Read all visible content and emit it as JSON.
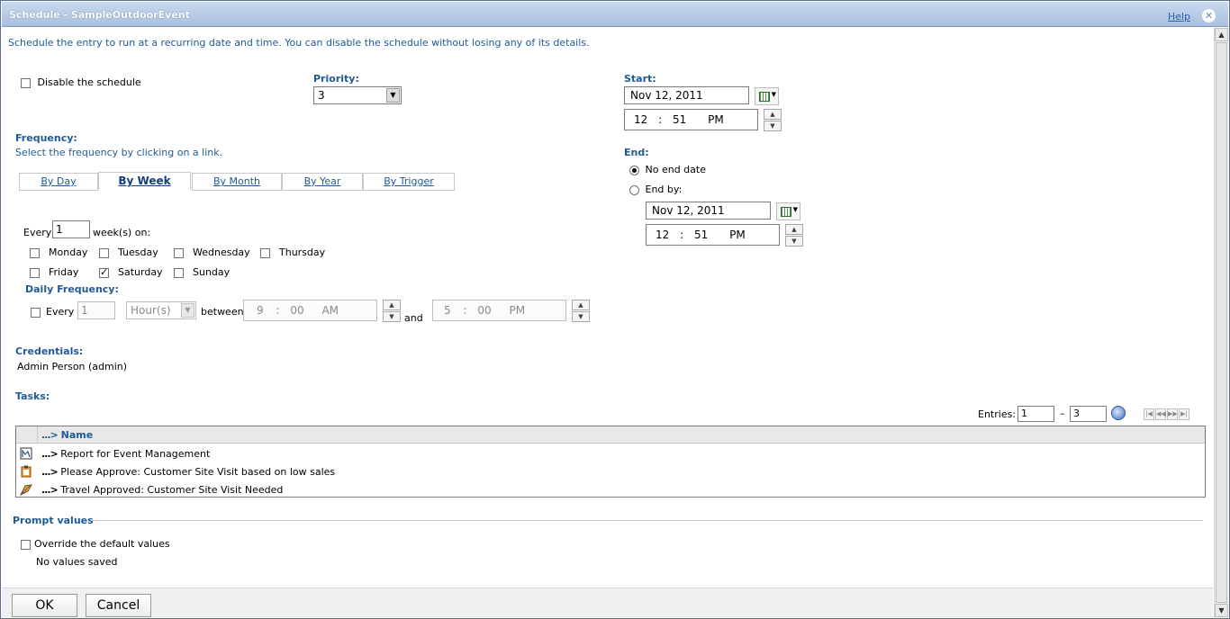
{
  "window": {
    "title": "Schedule - SampleOutdoorEvent",
    "help": "Help",
    "close": "✕"
  },
  "intro": "Schedule the entry to run at a recurring date and time. You can disable the schedule without losing any of its details.",
  "disable": {
    "label": "Disable the schedule",
    "checked": false
  },
  "priority": {
    "label": "Priority:",
    "value": "3"
  },
  "start": {
    "label": "Start:",
    "date": "Nov 12, 2011",
    "hour": "12",
    "minute": "51",
    "ampm": "PM"
  },
  "end": {
    "label": "End:",
    "no_end": "No end date",
    "end_by": "End by:",
    "date": "Nov 12, 2011",
    "hour": "12",
    "minute": "51",
    "ampm": "PM"
  },
  "frequency": {
    "label": "Frequency:",
    "hint": "Select the frequency by clicking on a link.",
    "tabs": [
      "By Day",
      "By Week",
      "By Month",
      "By Year",
      "By Trigger"
    ],
    "active_tab": "By Week",
    "every_label": "Every",
    "every_value": "1",
    "weeks_on": "week(s) on:",
    "days": [
      {
        "name": "Monday",
        "checked": false
      },
      {
        "name": "Tuesday",
        "checked": false
      },
      {
        "name": "Wednesday",
        "checked": false
      },
      {
        "name": "Thursday",
        "checked": false
      },
      {
        "name": "Friday",
        "checked": false
      },
      {
        "name": "Saturday",
        "checked": true
      },
      {
        "name": "Sunday",
        "checked": false
      }
    ]
  },
  "daily": {
    "label": "Daily Frequency:",
    "every": "Every",
    "every_value": "1",
    "unit": "Hour(s)",
    "between": "between",
    "from": {
      "hour": "9",
      "minute": "00",
      "ampm": "AM"
    },
    "and": "and",
    "to": {
      "hour": "5",
      "minute": "00",
      "ampm": "PM"
    }
  },
  "credentials": {
    "label": "Credentials:",
    "value": "Admin Person (admin)"
  },
  "tasks": {
    "label": "Tasks:",
    "entries_label": "Entries:",
    "entries_from": "1",
    "entries_dash": "–",
    "entries_to": "3",
    "column": "Name",
    "dots": "...>",
    "rows": [
      {
        "icon": "report-icon",
        "name": "Report for Event Management"
      },
      {
        "icon": "approval-icon",
        "name": "Please Approve: Customer Site Visit based on low sales"
      },
      {
        "icon": "notification-icon",
        "name": "Travel Approved: Customer Site Visit Needed"
      }
    ]
  },
  "prompt": {
    "label": "Prompt values",
    "override": "Override the default values",
    "saved": "No values saved"
  },
  "buttons": {
    "ok": "OK",
    "cancel": "Cancel"
  },
  "colors": {
    "accent": "#1f5a96",
    "titlebar": "#a9c0e0"
  }
}
